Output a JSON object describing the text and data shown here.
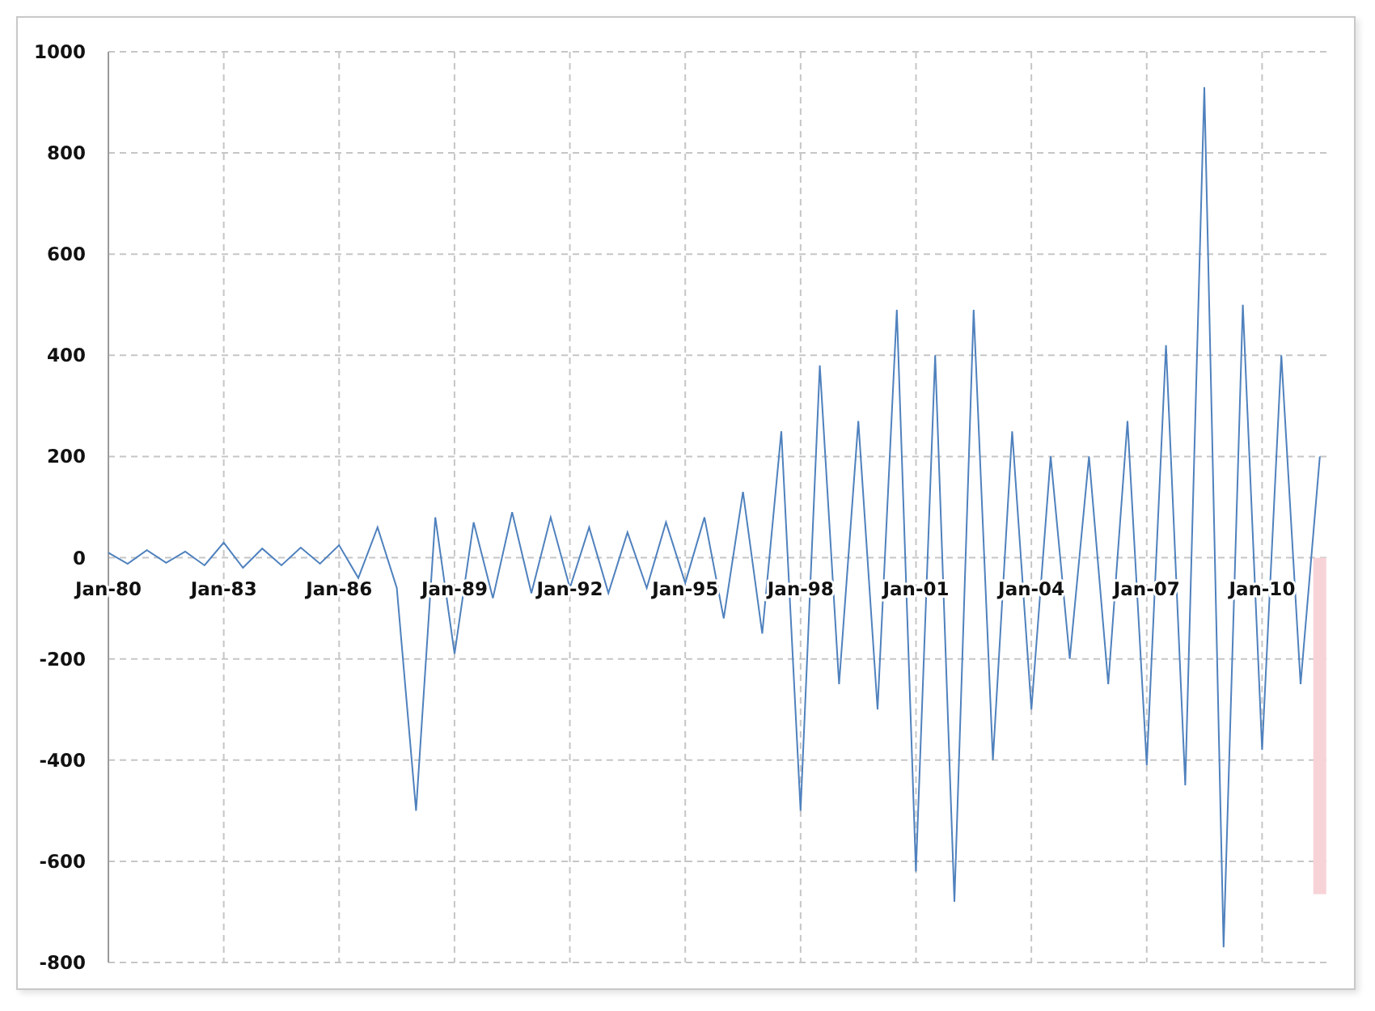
{
  "chart_data": {
    "type": "line",
    "grid": true,
    "ylim": [
      -800,
      1000
    ],
    "yticks": [
      -800,
      -600,
      -400,
      -200,
      0,
      200,
      400,
      600,
      800,
      1000
    ],
    "categories": [
      "Jan-80",
      null,
      null,
      null,
      null,
      null,
      "Jan-83",
      null,
      null,
      null,
      null,
      null,
      "Jan-86",
      null,
      null,
      null,
      null,
      null,
      "Jan-89",
      null,
      null,
      null,
      null,
      null,
      "Jan-92",
      null,
      null,
      null,
      null,
      null,
      "Jan-95",
      null,
      null,
      null,
      null,
      null,
      "Jan-98",
      null,
      null,
      null,
      null,
      null,
      "Jan-01",
      null,
      null,
      null,
      null,
      null,
      "Jan-04",
      null,
      null,
      null,
      null,
      null,
      "Jan-07",
      null,
      null,
      null,
      null,
      null,
      "Jan-10",
      null,
      null,
      null
    ],
    "series": [
      {
        "color": "#4f81bd",
        "values": [
          10,
          -12,
          15,
          -10,
          12,
          -15,
          30,
          -20,
          18,
          -15,
          20,
          -12,
          25,
          -40,
          60,
          -60,
          -500,
          80,
          -190,
          70,
          -80,
          90,
          -70,
          80,
          -60,
          60,
          -70,
          50,
          -60,
          70,
          -50,
          80,
          -120,
          130,
          -150,
          250,
          -500,
          380,
          -250,
          270,
          -300,
          490,
          -620,
          400,
          -680,
          490,
          -400,
          250,
          -300,
          200,
          -200,
          200,
          -250,
          270,
          -410,
          420,
          -450,
          930,
          -770,
          500,
          -380,
          400,
          -250,
          200
        ]
      },
      {
        "type": "bar",
        "color": "#f7d3d8",
        "values": [
          null,
          null,
          null,
          null,
          null,
          null,
          null,
          null,
          null,
          null,
          null,
          null,
          null,
          null,
          null,
          null,
          null,
          null,
          null,
          null,
          null,
          null,
          null,
          null,
          null,
          null,
          null,
          null,
          null,
          null,
          null,
          null,
          null,
          null,
          null,
          null,
          null,
          null,
          null,
          null,
          null,
          null,
          null,
          null,
          null,
          null,
          null,
          null,
          null,
          null,
          null,
          null,
          null,
          null,
          null,
          null,
          null,
          null,
          null,
          null,
          null,
          null,
          null,
          -665
        ]
      }
    ]
  }
}
